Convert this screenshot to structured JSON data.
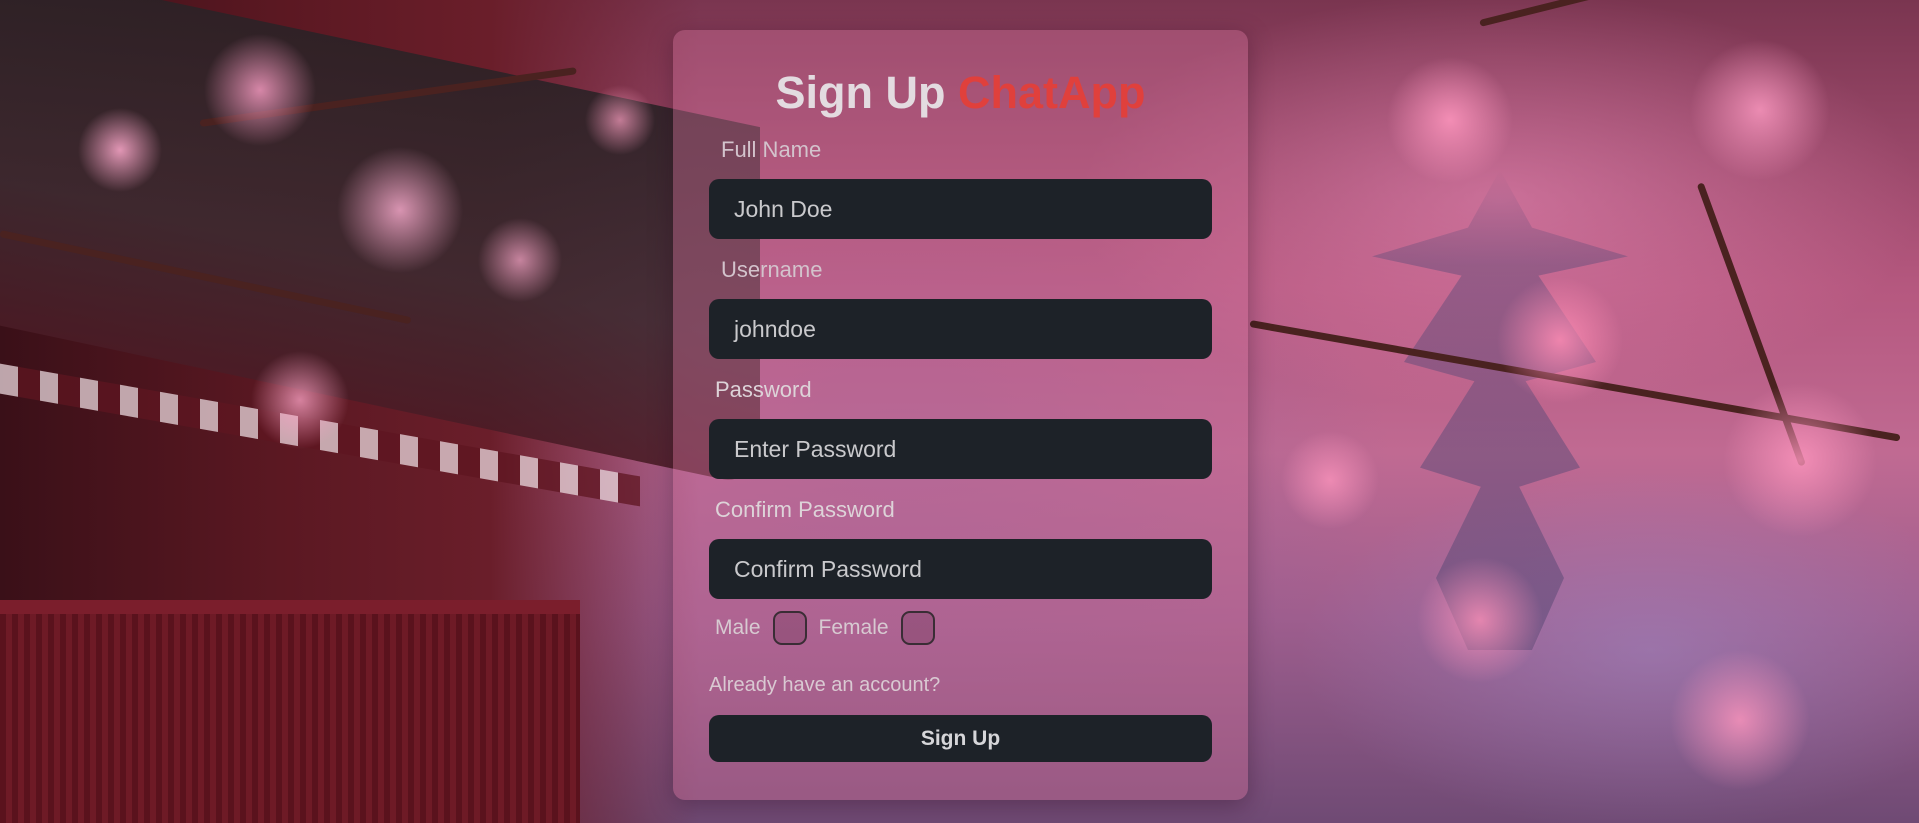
{
  "signup": {
    "title_main": "Sign Up",
    "title_brand": "ChatApp",
    "fields": {
      "full_name": {
        "label": "Full Name",
        "value": "John Doe"
      },
      "username": {
        "label": "Username",
        "value": "johndoe"
      },
      "password": {
        "label": "Password",
        "placeholder": "Enter Password"
      },
      "confirm_password": {
        "label": "Confirm Password",
        "placeholder": "Confirm Password"
      }
    },
    "gender": {
      "male_label": "Male",
      "female_label": "Female"
    },
    "login_link": "Already have an account?",
    "submit_label": "Sign Up"
  },
  "colors": {
    "brand": "#e0403c",
    "input_bg": "#1d2228"
  }
}
